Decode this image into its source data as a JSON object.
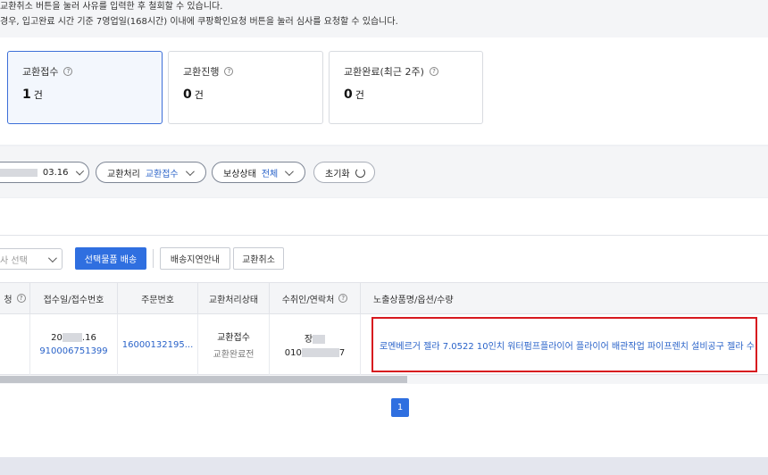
{
  "notice": {
    "line1": "교환취소 버튼을 눌러 사유를 입력한 후 철회할 수 있습니다.",
    "line2": "경우, 입고완료 시간 기준 7영업일(168시간) 이내에 쿠팡확인요청 버튼을 눌러 심사를 요청할 수 있습니다."
  },
  "summary": {
    "cards": [
      {
        "label": "교환접수",
        "count": "1",
        "unit": "건"
      },
      {
        "label": "교환진행",
        "count": "0",
        "unit": "건"
      },
      {
        "label": "교환완료(최근 2주)",
        "count": "0",
        "unit": "건"
      }
    ],
    "help_glyph": "?"
  },
  "filters": {
    "date_suffix": "03.16",
    "exchange_label": "교환처리",
    "exchange_value": "교환접수",
    "comp_label": "보상상태",
    "comp_value": "전체",
    "reset_label": "초기화"
  },
  "toolbar": {
    "select_placeholder": "사 선택",
    "ship_selected": "선택물품 배송",
    "delay_notice": "배송지연안내",
    "cancel_exchange": "교환취소"
  },
  "table": {
    "headers": [
      "청",
      "접수일/접수번호",
      "주문번호",
      "교환처리상태",
      "수취인/연락처",
      "노출상품명/옵션/수량"
    ],
    "row": {
      "date_prefix": "20",
      "date_suffix": ".16",
      "receipt_no": "910006751399",
      "order_no": "16000132195...",
      "status": "교환접수",
      "status_sub": "교환완료전",
      "name_prefix": "장",
      "phone_prefix": "010",
      "phone_suffix": "7",
      "product": "로멘베르거 젤라 7.0522 10인치 워터펌프플라이어 플라이어 배관작업 파이프렌치 설비공구 젤라 수..."
    }
  },
  "pagination": {
    "current": "1"
  }
}
